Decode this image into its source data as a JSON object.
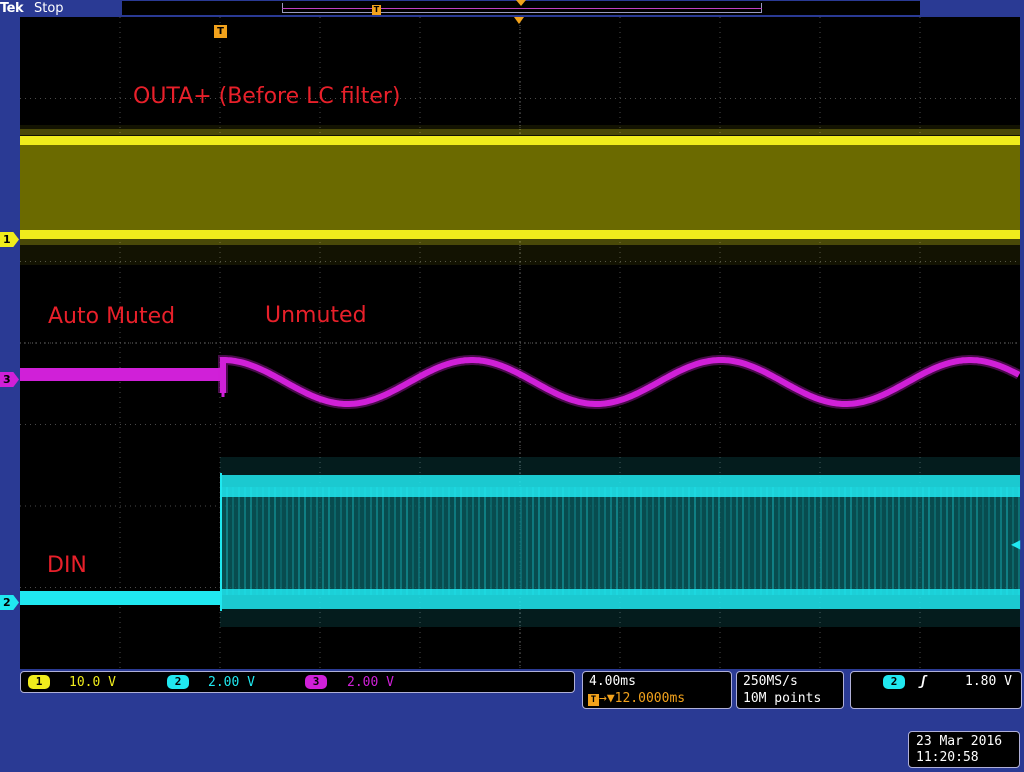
{
  "header": {
    "brand": "Tek",
    "status": "Stop"
  },
  "labels": {
    "ch1_annotation": "OUTA+ (Before LC filter)",
    "ch3_left_annotation": "Auto Muted",
    "ch3_right_annotation": "Unmuted",
    "ch2_annotation": "DIN"
  },
  "channels": [
    {
      "id": "1",
      "scale": "10.0 V",
      "color": "#f0ec1c"
    },
    {
      "id": "2",
      "scale": "2.00 V",
      "color": "#20e8f0"
    },
    {
      "id": "3",
      "scale": "2.00 V",
      "color": "#d020d8"
    }
  ],
  "markers": {
    "ch1": "1",
    "ch2": "2",
    "ch3": "3",
    "trigger": "T"
  },
  "horizontal": {
    "scale": "4.00ms",
    "delay": "▼12.0000ms",
    "delay_icon": "T→"
  },
  "acquisition": {
    "sample_rate": "250MS/s",
    "record_length": "10M points"
  },
  "trigger": {
    "source": "2",
    "slope_icon": "rising-edge-icon",
    "slope_glyph": "ʃ",
    "level": "1.80 V"
  },
  "datetime": {
    "date": "23 Mar 2016",
    "time": "11:20:58"
  }
}
